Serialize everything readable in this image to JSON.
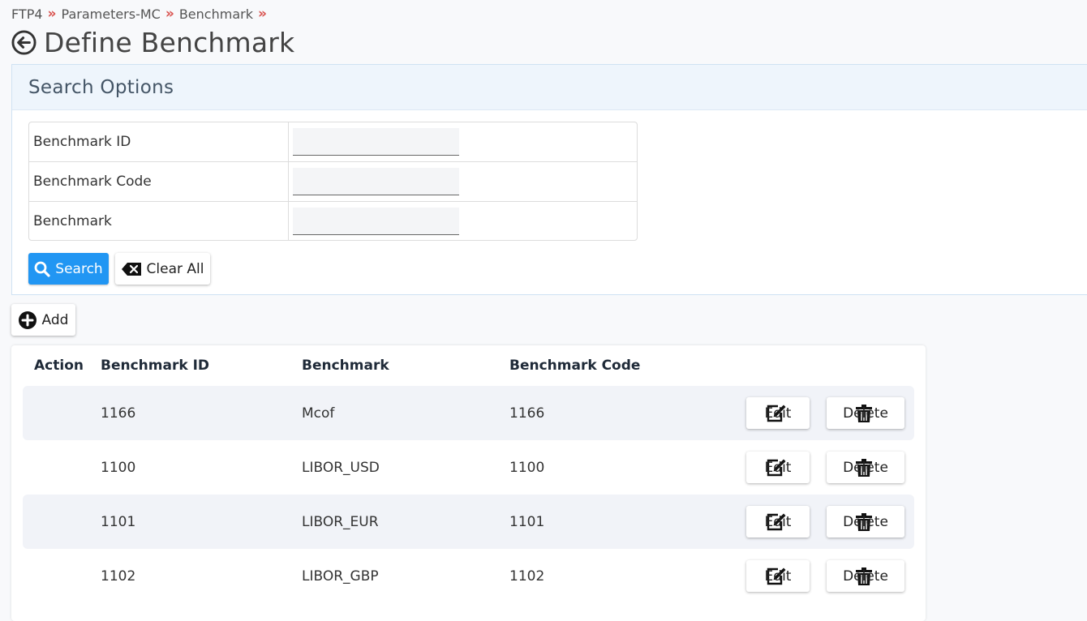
{
  "breadcrumb": {
    "items": [
      "FTP4",
      "Parameters-MC",
      "Benchmark"
    ],
    "separator": "»"
  },
  "page": {
    "title": "Define Benchmark"
  },
  "search": {
    "panel_title": "Search Options",
    "fields": [
      {
        "label": "Benchmark ID",
        "value": ""
      },
      {
        "label": "Benchmark Code",
        "value": ""
      },
      {
        "label": "Benchmark",
        "value": ""
      }
    ],
    "search_label": "Search",
    "clear_label": "Clear All"
  },
  "toolbar": {
    "add_label": "Add"
  },
  "grid": {
    "columns": [
      "Action",
      "Benchmark ID",
      "Benchmark",
      "Benchmark Code"
    ],
    "rows": [
      {
        "id": "1166",
        "benchmark": "Mcof",
        "code": "1166"
      },
      {
        "id": "1100",
        "benchmark": "LIBOR_USD",
        "code": "1100"
      },
      {
        "id": "1101",
        "benchmark": "LIBOR_EUR",
        "code": "1101"
      },
      {
        "id": "1102",
        "benchmark": "LIBOR_GBP",
        "code": "1102"
      }
    ],
    "edit_label": "Edit",
    "delete_label": "Delete"
  },
  "colors": {
    "accent": "#2196f3",
    "separator": "#d9534f",
    "panel_header": "#eef5fc",
    "row_alt": "#f1f3f8"
  }
}
